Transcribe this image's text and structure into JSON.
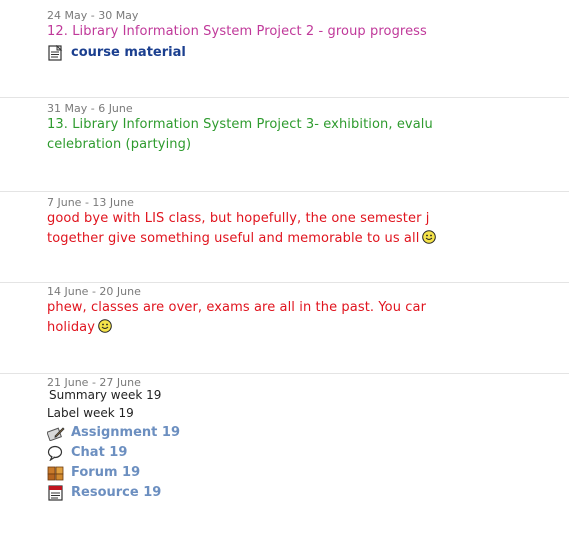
{
  "colors": {
    "week12_heading": "#c0399a",
    "week13_heading": "#2e9b2e",
    "red_text": "#e0141e",
    "link_dark": "#1b3f8f",
    "link_blue": "#6c8fc0"
  },
  "weeks": [
    {
      "date": "24 May - 30 May",
      "lines": [
        "12. Library Information System Project 2 - group progress"
      ],
      "resources": [
        {
          "label": "course material",
          "icon": "document-icon"
        }
      ]
    },
    {
      "date": "31 May - 6 June",
      "lines": [
        "13. Library Information System Project 3- exhibition, evalu",
        "celebration (partying)"
      ]
    },
    {
      "date": "7 June - 13 June",
      "lines": [
        "good bye with LIS class, but hopefully, the one semester j",
        "together give something useful and memorable to us all"
      ]
    },
    {
      "date": "14 June - 20 June",
      "lines": [
        "phew, classes are over, exams are all in the past. You car",
        "holiday"
      ]
    },
    {
      "date": "21 June - 27 June",
      "summary": "Summary week 19",
      "label": "Label week 19",
      "resources": [
        {
          "label": "Assignment 19",
          "icon": "assignment-icon"
        },
        {
          "label": "Chat 19",
          "icon": "chat-icon"
        },
        {
          "label": "Forum 19",
          "icon": "forum-icon"
        },
        {
          "label": "Resource 19",
          "icon": "resource-icon"
        }
      ]
    }
  ]
}
